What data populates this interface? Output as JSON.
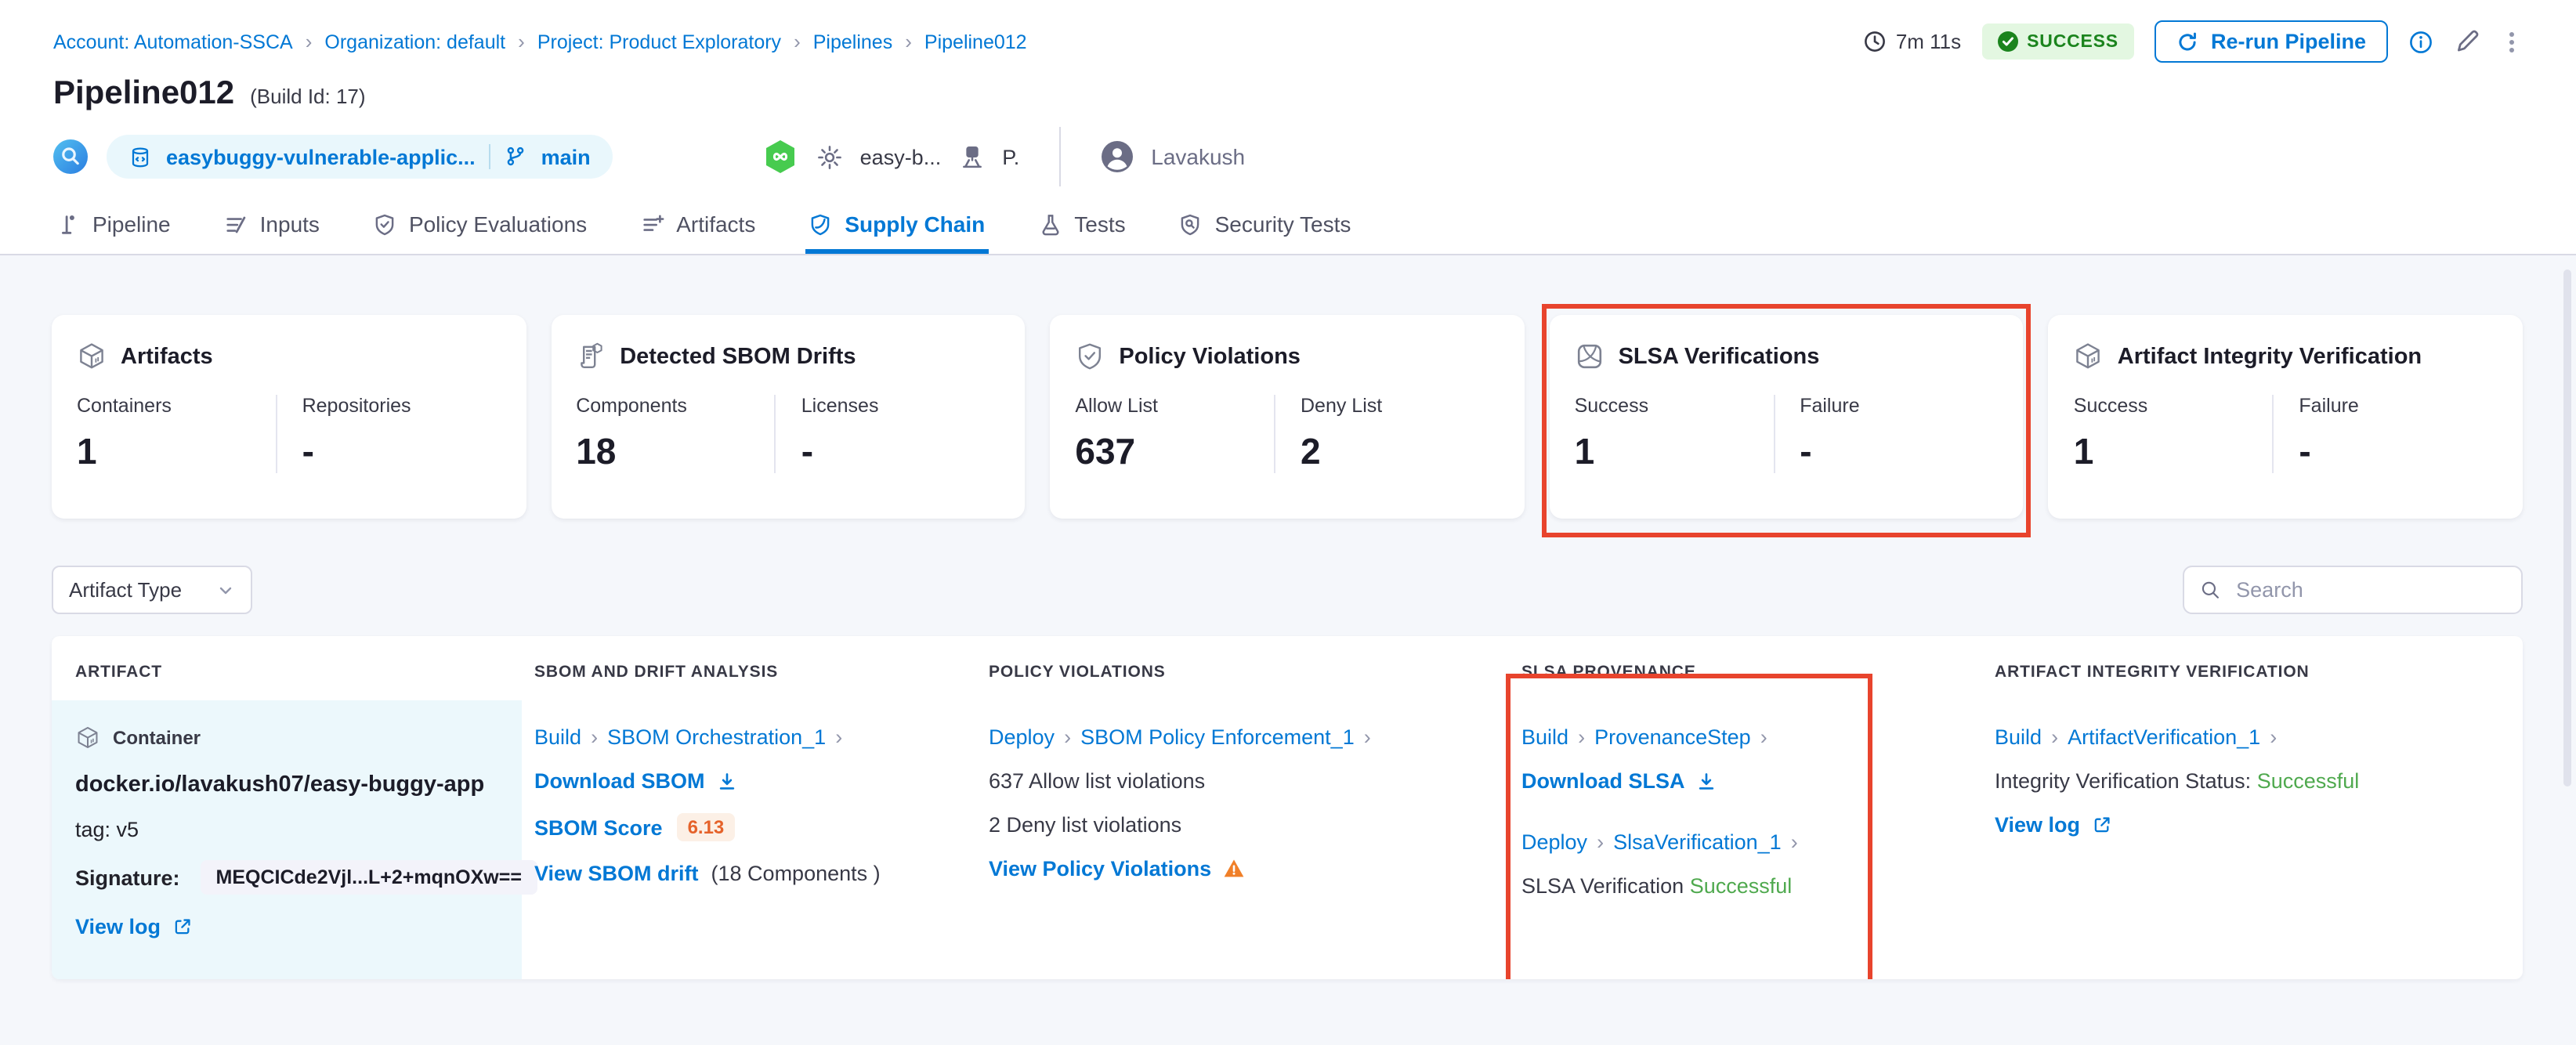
{
  "breadcrumb": {
    "items": [
      "Account: Automation-SSCA",
      "Organization: default",
      "Project: Product Exploratory",
      "Pipelines",
      "Pipeline012"
    ]
  },
  "run_header": {
    "title": "Pipeline012",
    "build_id": "(Build Id: 17)",
    "duration": "7m 11s",
    "status": "SUCCESS",
    "rerun": "Re-run Pipeline",
    "repo": "easybuggy-vulnerable-applic...",
    "branch": "main",
    "trigger_service": "easy-b...",
    "trigger_infra": "P.",
    "user": "Lavakush"
  },
  "tabs": [
    {
      "label": "Pipeline",
      "active": false
    },
    {
      "label": "Inputs",
      "active": false
    },
    {
      "label": "Policy Evaluations",
      "active": false
    },
    {
      "label": "Artifacts",
      "active": false
    },
    {
      "label": "Supply Chain",
      "active": true
    },
    {
      "label": "Tests",
      "active": false
    },
    {
      "label": "Security Tests",
      "active": false
    }
  ],
  "cards": [
    {
      "title": "Artifacts",
      "icon": "cube-icon",
      "cols": [
        {
          "label": "Containers",
          "value": "1"
        },
        {
          "label": "Repositories",
          "value": "-"
        }
      ],
      "highlighted": false
    },
    {
      "title": "Detected SBOM Drifts",
      "icon": "sbom-scroll-icon",
      "cols": [
        {
          "label": "Components",
          "value": "18"
        },
        {
          "label": "Licenses",
          "value": "-"
        }
      ],
      "highlighted": false
    },
    {
      "title": "Policy Violations",
      "icon": "shield-check-icon",
      "cols": [
        {
          "label": "Allow List",
          "value": "637"
        },
        {
          "label": "Deny List",
          "value": "2"
        }
      ],
      "highlighted": false
    },
    {
      "title": "SLSA Verifications",
      "icon": "slsa-icon",
      "cols": [
        {
          "label": "Success",
          "value": "1"
        },
        {
          "label": "Failure",
          "value": "-"
        }
      ],
      "highlighted": true
    },
    {
      "title": "Artifact Integrity Verification",
      "icon": "cube-icon",
      "cols": [
        {
          "label": "Success",
          "value": "1"
        },
        {
          "label": "Failure",
          "value": "-"
        }
      ],
      "highlighted": false
    }
  ],
  "filters": {
    "artifact_type": "Artifact Type",
    "search_placeholder": "Search"
  },
  "table": {
    "headers": [
      "ARTIFACT",
      "SBOM AND DRIFT ANALYSIS",
      "POLICY VIOLATIONS",
      "SLSA PROVENANCE",
      "ARTIFACT INTEGRITY VERIFICATION"
    ],
    "row": {
      "artifact": {
        "kind": "Container",
        "image": "docker.io/lavakush07/easy-buggy-app",
        "tag": "tag: v5",
        "signature_label": "Signature:",
        "signature": "MEQCICde2Vjl...L+2+mqnOXw==",
        "view_log": "View log"
      },
      "sbom": {
        "stage": "Build",
        "step": "SBOM Orchestration_1",
        "download": "Download SBOM",
        "score_label": "SBOM Score",
        "score": "6.13",
        "drift_link": "View SBOM drift",
        "drift_note": "(18 Components )"
      },
      "policy": {
        "stage": "Deploy",
        "step": "SBOM Policy Enforcement_1",
        "allow": "637 Allow list violations",
        "deny": "2 Deny list violations",
        "link": "View Policy Violations"
      },
      "slsa": {
        "stage1": "Build",
        "step1": "ProvenanceStep",
        "download": "Download SLSA",
        "stage2": "Deploy",
        "step2": "SlsaVerification_1",
        "status_label": "SLSA Verification",
        "status": "Successful"
      },
      "integrity": {
        "stage": "Build",
        "step": "ArtifactVerification_1",
        "status_label": "Integrity Verification Status:",
        "status": "Successful",
        "view_log": "View log"
      }
    }
  },
  "colors": {
    "accent_blue": "#0278d5",
    "success_badge_bg": "#e3f7e1",
    "success_badge_text": "#1b841d",
    "success_green": "#4fa94e",
    "annotation_red": "#e8442d",
    "score_orange": "#e5622a",
    "score_bg": "#fcf0e6",
    "warning_orange": "#f07f28",
    "artifact_cell_bg": "#ecf8fc"
  },
  "icons": {
    "duration": "clock",
    "status": "check-circle",
    "rerun": "refresh",
    "search": "magnifier",
    "download": "arrow-down-to-line",
    "external_link": "arrow-up-right-box",
    "warning": "triangle-exclamation"
  }
}
